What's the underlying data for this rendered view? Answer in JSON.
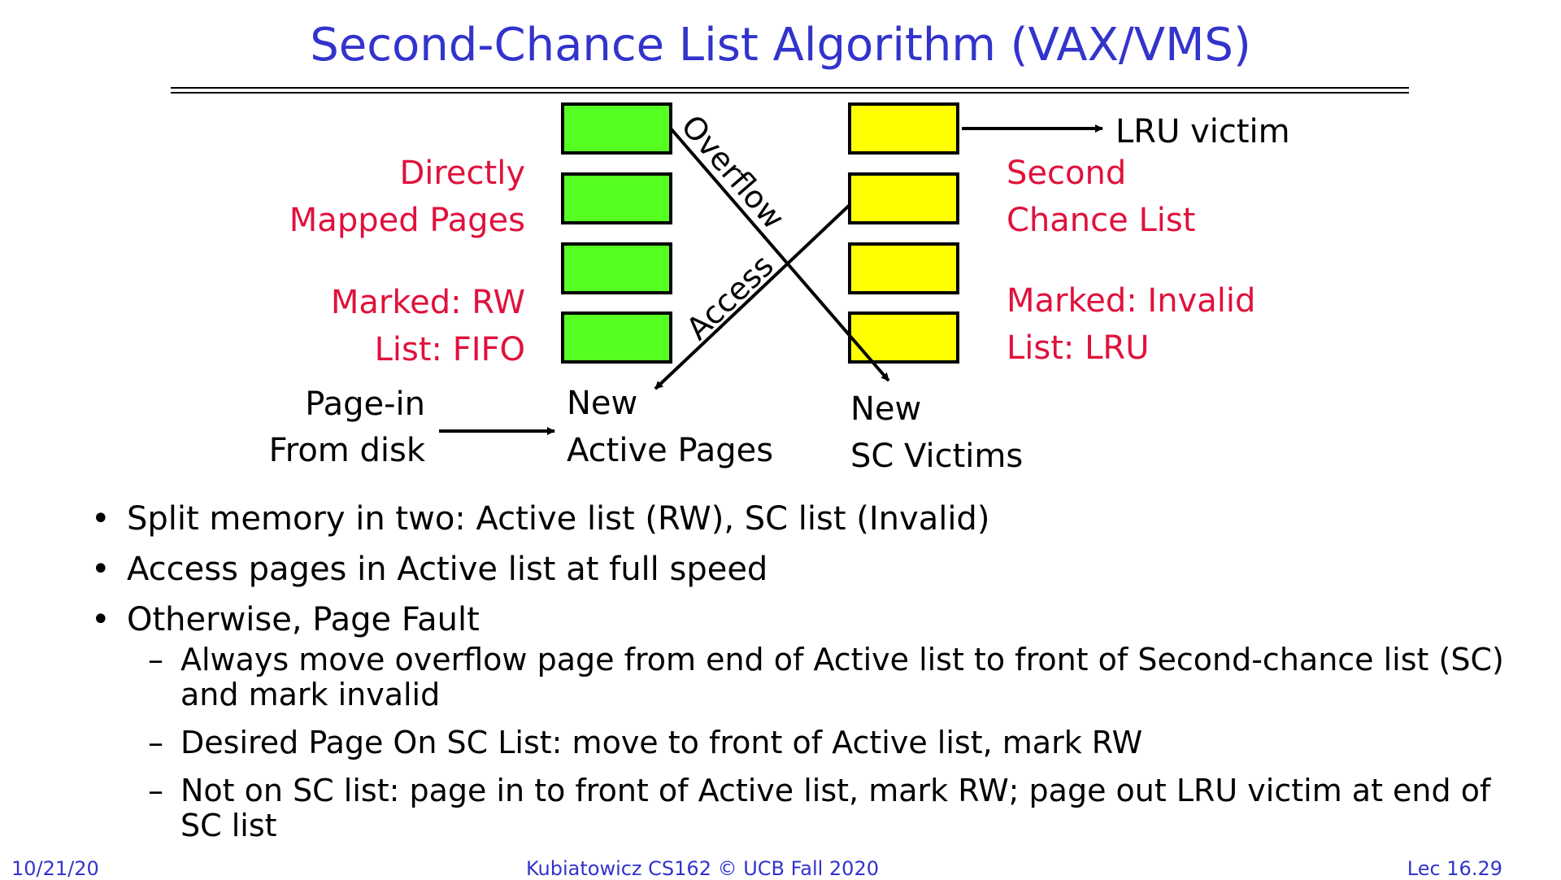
{
  "slide": {
    "title": "Second-Chance List Algorithm (VAX/VMS)",
    "footer": {
      "date": "10/21/20",
      "center": "Kubiatowicz CS162 © UCB Fall 2020",
      "page": "Lec 16.29"
    }
  },
  "diagram": {
    "active_label_1": "Directly",
    "active_label_2": "Mapped Pages",
    "active_marked": "Marked: RW",
    "active_list": "List: FIFO",
    "pagein_1": "Page-in",
    "pagein_2": "From disk",
    "new_active_1": "New",
    "new_active_2": "Active Pages",
    "sc_label_1": "Second",
    "sc_label_2": "Chance List",
    "sc_marked": "Marked: Invalid",
    "sc_list": "List: LRU",
    "new_sc_1": "New",
    "new_sc_2": "SC Victims",
    "lru_victim": "LRU victim",
    "overflow": "Overflow",
    "access": "Access",
    "colors": {
      "active_box": "#55ff22",
      "sc_box": "#ffff00",
      "label_red": "#e0113c",
      "title_blue": "#3333cc"
    }
  },
  "bullets": [
    {
      "text": "Split memory in two: Active list (RW), SC list (Invalid)"
    },
    {
      "text": "Access pages in Active list at full speed"
    },
    {
      "text": "Otherwise, Page Fault",
      "sub": [
        "Always move overflow page from end of Active list to front of Second-chance list (SC) and mark invalid",
        "Desired Page On SC List: move to front of Active list, mark RW",
        "Not on SC list: page in to front of Active list, mark RW; page out LRU victim at end of SC list"
      ]
    }
  ]
}
